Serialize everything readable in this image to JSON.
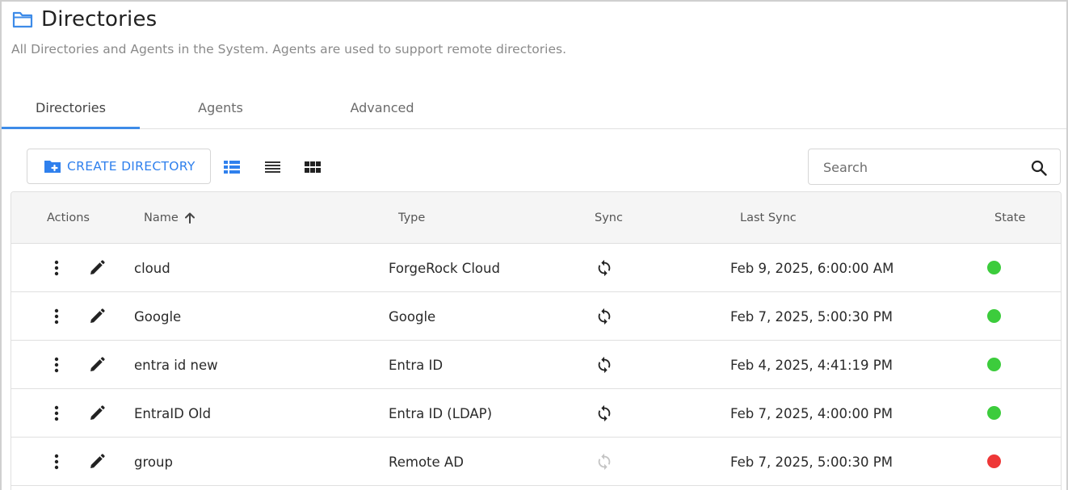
{
  "header": {
    "title": "Directories",
    "subtitle": "All Directories and Agents in the System. Agents are used to support remote directories."
  },
  "tabs": [
    {
      "label": "Directories",
      "active": true
    },
    {
      "label": "Agents",
      "active": false
    },
    {
      "label": "Advanced",
      "active": false
    }
  ],
  "toolbar": {
    "create_label": "CREATE DIRECTORY",
    "view_modes": [
      "card-list-view-icon",
      "list-view-icon",
      "grid-view-icon"
    ]
  },
  "search": {
    "placeholder": "Search",
    "value": ""
  },
  "table": {
    "columns": [
      "Actions",
      "Name",
      "Type",
      "Sync",
      "Last Sync",
      "State"
    ],
    "sorted_by": "Name",
    "sort_direction": "ascending",
    "rows": [
      {
        "name": "cloud",
        "type": "ForgeRock Cloud",
        "sync_enabled": true,
        "last_sync": "Feb 9, 2025, 6:00:00 AM",
        "state": "green"
      },
      {
        "name": "Google",
        "type": "Google",
        "sync_enabled": true,
        "last_sync": "Feb 7, 2025, 5:00:30 PM",
        "state": "green"
      },
      {
        "name": "entra id new",
        "type": "Entra ID",
        "sync_enabled": true,
        "last_sync": "Feb 4, 2025, 4:41:19 PM",
        "state": "green"
      },
      {
        "name": "EntraID Old",
        "type": "Entra ID (LDAP)",
        "sync_enabled": true,
        "last_sync": "Feb 7, 2025, 4:00:00 PM",
        "state": "green"
      },
      {
        "name": "group",
        "type": "Remote AD",
        "sync_enabled": false,
        "last_sync": "Feb 7, 2025, 5:00:30 PM",
        "state": "red"
      }
    ]
  },
  "colors": {
    "accent": "#2f80ed",
    "tab_underline": "#3d8be8",
    "state_green": "#3ccc3c",
    "state_red": "#ee3737",
    "sync_active": "#222222",
    "sync_inactive": "#c4c4c4"
  }
}
